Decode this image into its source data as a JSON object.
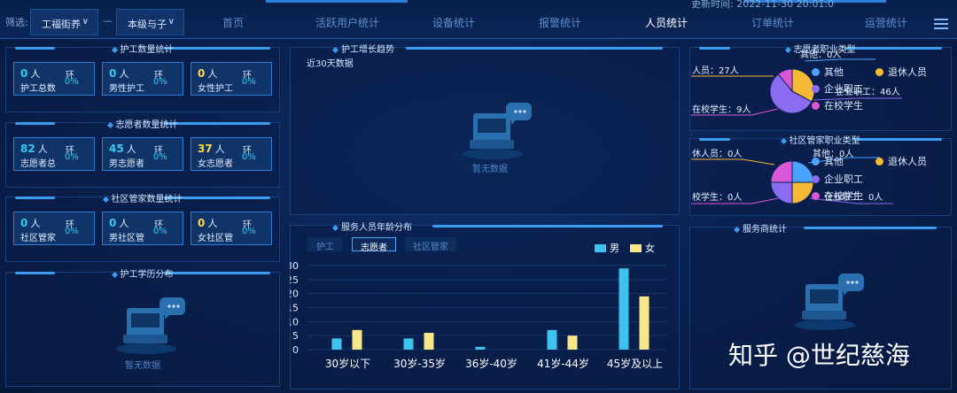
{
  "filters": {
    "label": "筛选:",
    "street": "工福街养",
    "scope": "本级与子",
    "separator": "—"
  },
  "nav": [
    {
      "label": "首页",
      "active": false
    },
    {
      "label": "活跃用户统计",
      "active": false
    },
    {
      "label": "设备统计",
      "active": false
    },
    {
      "label": "报警统计",
      "active": false
    },
    {
      "label": "人员统计",
      "active": true
    },
    {
      "label": "订单统计",
      "active": false
    },
    {
      "label": "运营统计",
      "active": false
    }
  ],
  "update_time": "更新时间: 2022-11-30 20:01:0",
  "panels": {
    "caregiver_count": {
      "title": "护工数量统计",
      "cards": [
        {
          "value": "0",
          "unit": "人",
          "label": "护工总数",
          "ring": "环",
          "pct": "0%",
          "color": "#35c9f2"
        },
        {
          "value": "0",
          "unit": "人",
          "label": "男性护工",
          "ring": "环",
          "pct": "0%",
          "color": "#35c9f2"
        },
        {
          "value": "0",
          "unit": "人",
          "label": "女性护工",
          "ring": "环",
          "pct": "0%",
          "color": "#ffd84a"
        }
      ]
    },
    "volunteer_count": {
      "title": "志愿者数量统计",
      "cards": [
        {
          "value": "82",
          "unit": "人",
          "label": "志愿者总",
          "ring": "环",
          "pct": "0%",
          "color": "#35c9f2"
        },
        {
          "value": "45",
          "unit": "人",
          "label": "男志愿者",
          "ring": "环",
          "pct": "0%",
          "color": "#35c9f2"
        },
        {
          "value": "37",
          "unit": "人",
          "label": "女志愿者",
          "ring": "环",
          "pct": "0%",
          "color": "#ffd84a"
        }
      ]
    },
    "manager_count": {
      "title": "社区管家数量统计",
      "cards": [
        {
          "value": "0",
          "unit": "人",
          "label": "社区管家",
          "ring": "环",
          "pct": "0%",
          "color": "#35c9f2"
        },
        {
          "value": "0",
          "unit": "人",
          "label": "男社区管",
          "ring": "环",
          "pct": "0%",
          "color": "#35c9f2"
        },
        {
          "value": "0",
          "unit": "人",
          "label": "女社区管",
          "ring": "环",
          "pct": "0%",
          "color": "#ffd84a"
        }
      ]
    },
    "caregiver_edu": {
      "title": "护工学历分布",
      "empty": "暂无数据"
    },
    "caregiver_trend": {
      "title": "护工增长趋势",
      "subtitle": "近30天数据",
      "empty": "暂无数据"
    },
    "age_dist": {
      "title": "服务人员年龄分布",
      "tabs": [
        "护工",
        "志愿者",
        "社区管家"
      ],
      "active_tab": 1
    },
    "volunteer_job": {
      "title": "志愿者职业类型",
      "legend": [
        "其他",
        "退休人员",
        "企业职工",
        "在校学生"
      ],
      "callouts": [
        "其他：0人",
        "人员：27人",
        "企业职工：46人",
        "在校学生：9人"
      ]
    },
    "manager_job": {
      "title": "社区管家职业类型",
      "legend": [
        "其他",
        "退休人员",
        "企业职工",
        "在校学生"
      ],
      "callouts": [
        "其他：0人",
        "休人员：0人",
        "校学生：0人",
        "企业职工：0人"
      ]
    },
    "provider": {
      "title": "服务商统计"
    }
  },
  "colors": {
    "其他": "#4aa3ff",
    "退休人员": "#f5b935",
    "企业职工": "#8b6cf0",
    "在校学生": "#d858d8",
    "male": "#3ec3ee",
    "female": "#f8e788"
  },
  "chart_data": {
    "type": "bar",
    "categories": [
      "30岁以下",
      "30岁-35岁",
      "36岁-40岁",
      "41岁-44岁",
      "45岁及以上"
    ],
    "series": [
      {
        "name": "男",
        "values": [
          4,
          4,
          1,
          7,
          29
        ]
      },
      {
        "name": "女",
        "values": [
          7,
          6,
          0,
          5,
          19
        ]
      }
    ],
    "yticks": [
      "30",
      "25",
      "20",
      "15",
      "10",
      "5",
      "0"
    ],
    "ylim": [
      0,
      30
    ],
    "legend": "top-right"
  },
  "pie_data": [
    {
      "slices": [
        {
          "name": "其他",
          "value": 0
        },
        {
          "name": "退休人员",
          "value": 27
        },
        {
          "name": "企业职工",
          "value": 46
        },
        {
          "name": "在校学生",
          "value": 9
        }
      ]
    },
    {
      "slices": [
        {
          "name": "其他",
          "value": 1
        },
        {
          "name": "退休人员",
          "value": 1
        },
        {
          "name": "企业职工",
          "value": 1
        },
        {
          "name": "在校学生",
          "value": 1
        }
      ]
    }
  ],
  "watermark": "知乎 @世纪慈海"
}
